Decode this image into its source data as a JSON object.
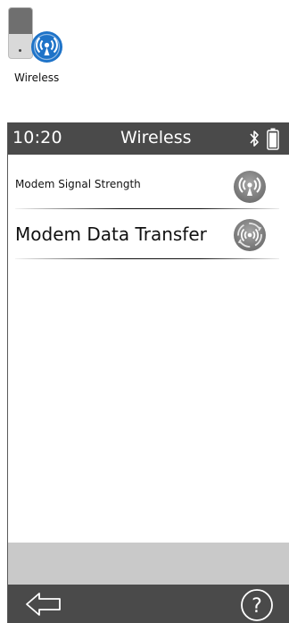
{
  "app_icon": {
    "label": "Wireless",
    "icon": "wireless-app-icon",
    "accent_color": "#1e73c8"
  },
  "status_bar": {
    "time": "10:20",
    "title": "Wireless",
    "icons": [
      "bluetooth-icon",
      "battery-icon"
    ]
  },
  "menu": {
    "items": [
      {
        "label": "Modem Signal Strength",
        "icon": "signal-strength-icon"
      },
      {
        "label": "Modem Data Transfer",
        "icon": "data-transfer-icon"
      }
    ]
  },
  "bottom_bar": {
    "icons": [
      "back-arrow-icon",
      "help-icon"
    ],
    "help_glyph": "?"
  },
  "colors": {
    "bar_background": "#4a4a4a",
    "footer_band": "#c9c9c9",
    "menu_icon_gray": "#8a8a8a"
  }
}
